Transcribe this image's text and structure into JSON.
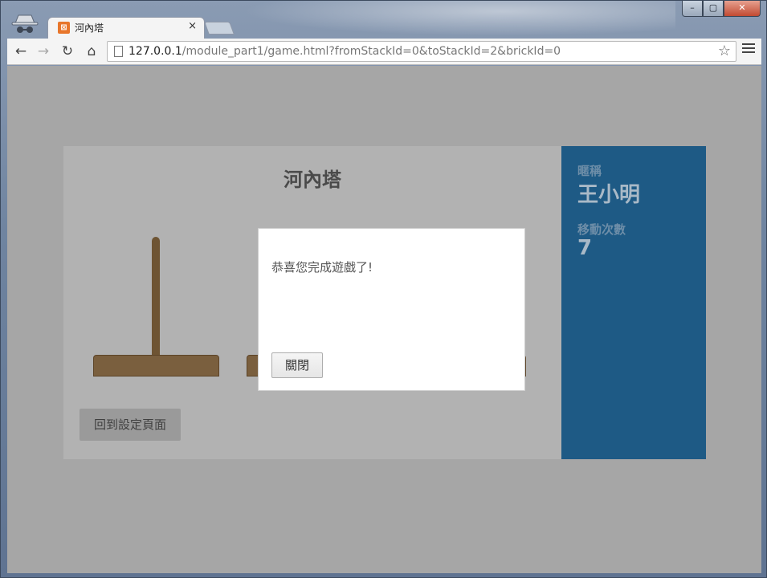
{
  "browser": {
    "tab_title": "河內塔",
    "tab_close": "×",
    "url_host": "127.0.0.1",
    "url_path": "/module_part1/game.html?fromStackId=0&toStackId=2&brickId=0",
    "window_close": "✕",
    "window_min": "–",
    "window_max": "▢",
    "star_glyph": "☆",
    "back_glyph": "←",
    "forward_glyph": "→",
    "reload_glyph": "↻",
    "home_glyph": "⌂",
    "tab_favicon_glyph": "⊠"
  },
  "game": {
    "title": "河內塔",
    "back_button_label": "回到設定頁面"
  },
  "info": {
    "nickname_label": "暱稱",
    "nickname_value": "王小明",
    "moves_label": "移動次數",
    "moves_value": "7"
  },
  "modal": {
    "message": "恭喜您完成遊戲了!",
    "close_button_label": "關閉"
  },
  "colors": {
    "info_panel": "#1e5a85",
    "wood": "#7a5f3e",
    "overlay": "#a6a6a6"
  }
}
